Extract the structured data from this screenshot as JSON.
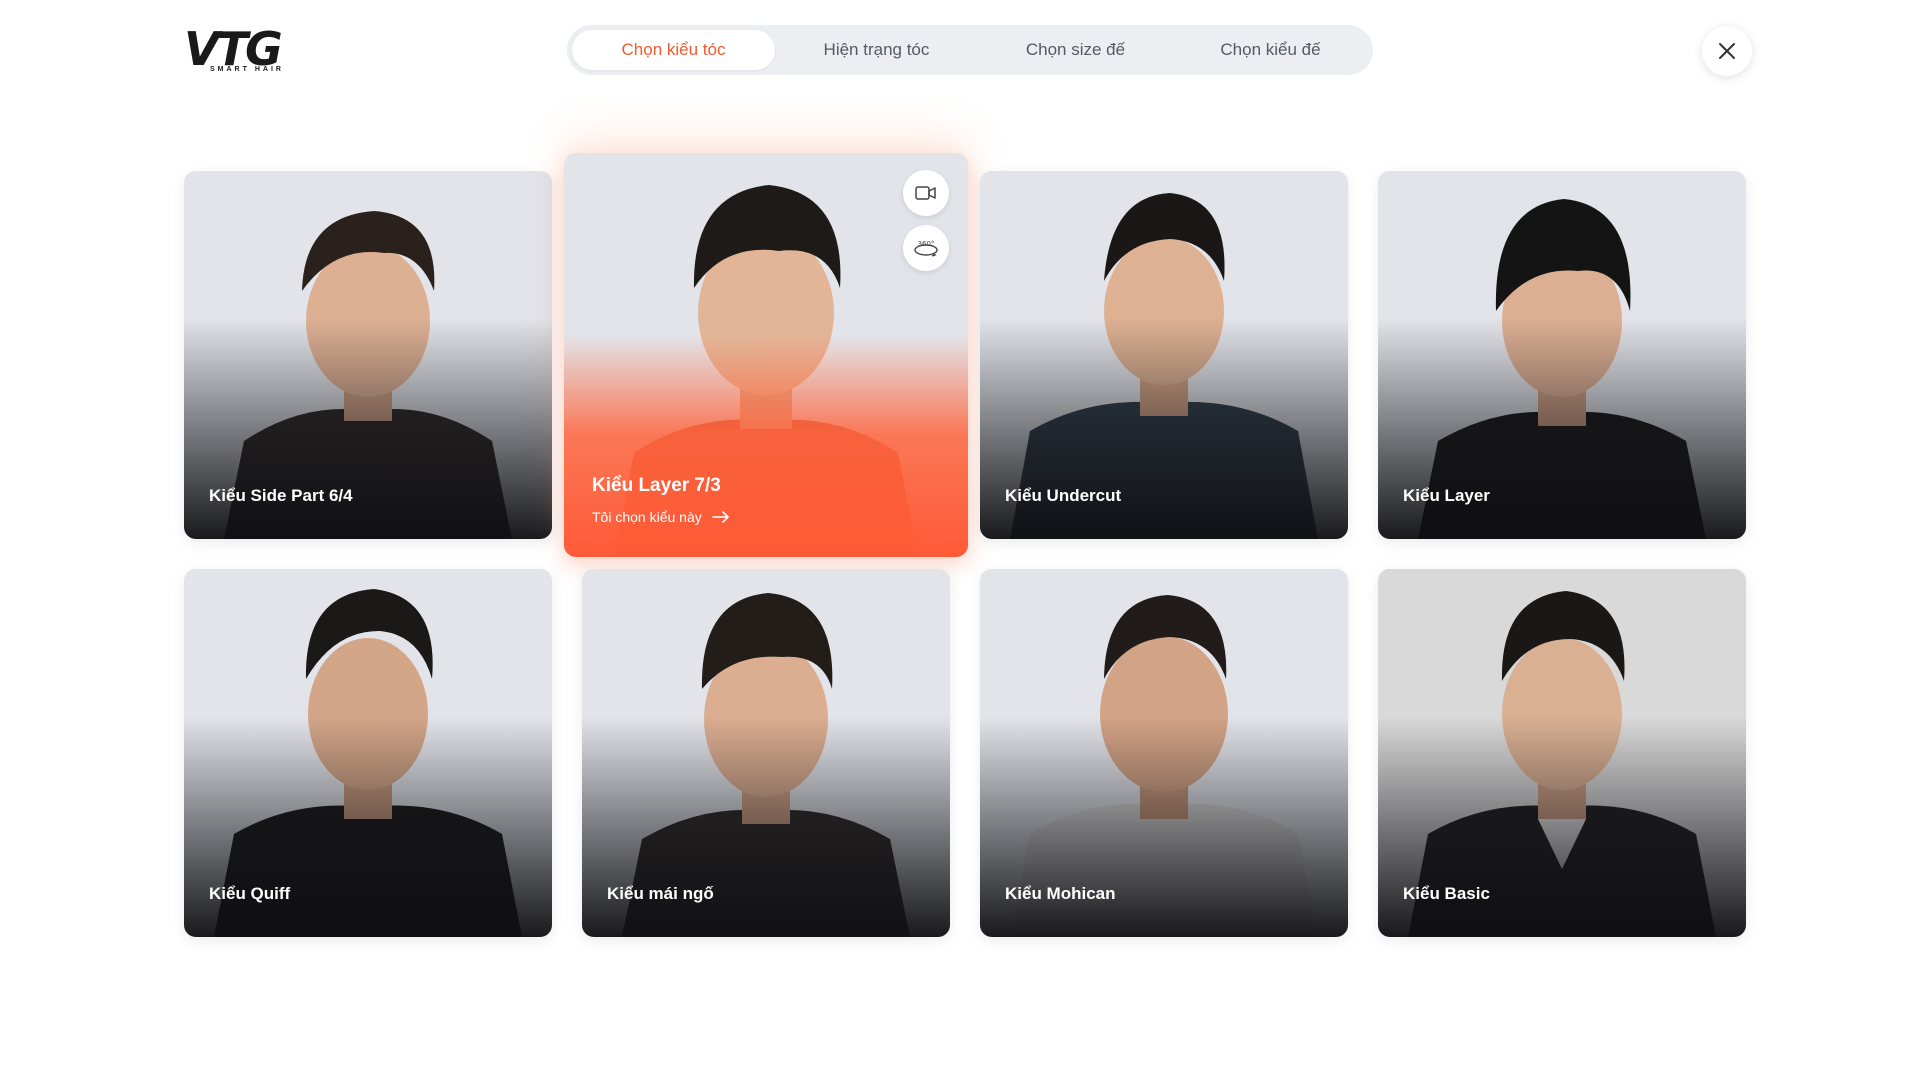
{
  "brand": {
    "logo_text": "VTG",
    "logo_sub": "SMART HAIR"
  },
  "tabs": [
    {
      "label": "Chọn kiểu tóc",
      "active": true
    },
    {
      "label": "Hiện trạng tóc",
      "active": false
    },
    {
      "label": "Chọn size đế",
      "active": false
    },
    {
      "label": "Chọn kiểu đế",
      "active": false
    }
  ],
  "accent_color": "#f05a2e",
  "styles": [
    {
      "name": "Kiểu Side Part 6/4"
    },
    {
      "name": "Kiểu Layer 7/3",
      "selected": true,
      "cta": "Tôi chọn kiểu này",
      "actions": [
        "video-icon",
        "rotate-360-icon"
      ]
    },
    {
      "name": "Kiểu Undercut"
    },
    {
      "name": "Kiểu Layer"
    },
    {
      "name": "Kiểu Quiff"
    },
    {
      "name": "Kiểu mái ngố"
    },
    {
      "name": "Kiểu Mohican"
    },
    {
      "name": "Kiểu Basic"
    }
  ]
}
